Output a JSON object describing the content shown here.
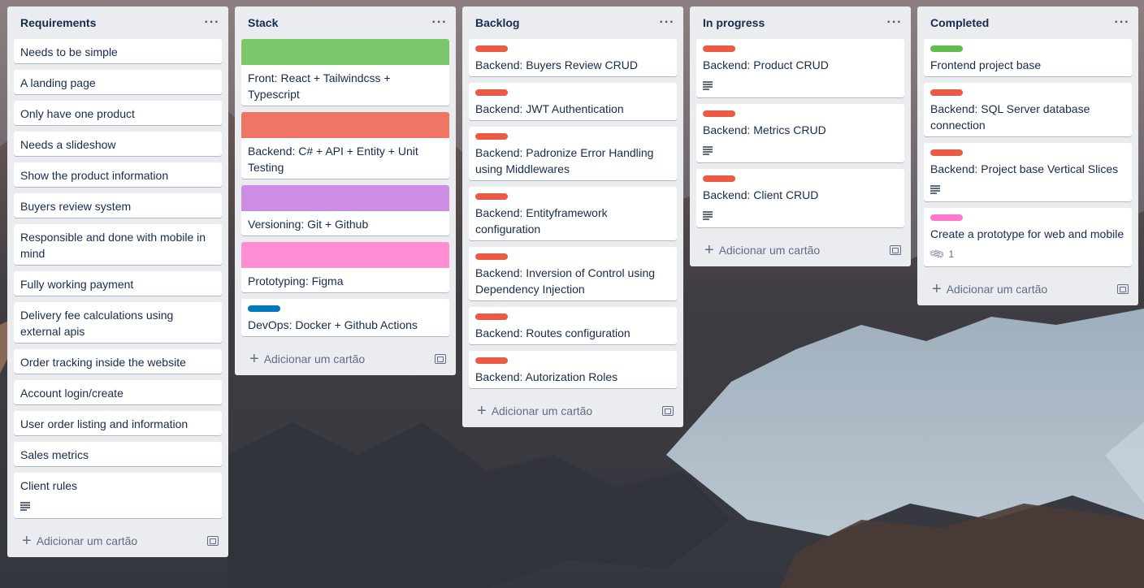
{
  "colors": {
    "red": "#eb5a46",
    "green": "#61bd4f",
    "blue": "#0079bf",
    "pink": "#ff78cb",
    "cover_green": "#7bc86c",
    "cover_salmon": "#ef7564",
    "cover_purple": "#cd8de5",
    "cover_pink": "#ff8ed4"
  },
  "icons": {
    "menu": "···",
    "plus": "+",
    "attachment": "paperclip-icon"
  },
  "lists": [
    {
      "title": "Requirements",
      "add_label": "Adicionar um cartão",
      "cards": [
        {
          "title": "Needs to be simple"
        },
        {
          "title": "A landing page"
        },
        {
          "title": "Only have one product"
        },
        {
          "title": "Needs a slideshow"
        },
        {
          "title": "Show the product information"
        },
        {
          "title": "Buyers review system"
        },
        {
          "title": "Responsible and done with mobile in mind"
        },
        {
          "title": "Fully working payment"
        },
        {
          "title": "Delivery fee calculations using external apis"
        },
        {
          "title": "Order tracking inside the website"
        },
        {
          "title": "Account login/create"
        },
        {
          "title": "User order listing and information"
        },
        {
          "title": "Sales metrics"
        },
        {
          "title": "Client rules",
          "has_description": true
        }
      ]
    },
    {
      "title": "Stack",
      "add_label": "Adicionar um cartão",
      "cards": [
        {
          "title": "Front: React + Tailwindcss + Typescript",
          "cover": "#7bc86c"
        },
        {
          "title": "Backend: C# + API + Entity + Unit Testing",
          "cover": "#ef7564"
        },
        {
          "title": "Versioning: Git + Github",
          "cover": "#cd8de5"
        },
        {
          "title": "Prototyping: Figma",
          "cover": "#ff8ed4"
        },
        {
          "title": "DevOps: Docker + Github Actions",
          "label": "#0079bf"
        }
      ]
    },
    {
      "title": "Backlog",
      "add_label": "Adicionar um cartão",
      "cards": [
        {
          "title": "Backend: Buyers Review CRUD",
          "label": "#eb5a46"
        },
        {
          "title": "Backend: JWT Authentication",
          "label": "#eb5a46"
        },
        {
          "title": "Backend: Padronize Error Handling using Middlewares",
          "label": "#eb5a46"
        },
        {
          "title": "Backend: Entityframework configuration",
          "label": "#eb5a46"
        },
        {
          "title": "Backend: Inversion of Control using Dependency Injection",
          "label": "#eb5a46"
        },
        {
          "title": "Backend: Routes configuration",
          "label": "#eb5a46"
        },
        {
          "title": "Backend: Autorization Roles",
          "label": "#eb5a46"
        }
      ]
    },
    {
      "title": "In progress",
      "add_label": "Adicionar um cartão",
      "cards": [
        {
          "title": "Backend: Product CRUD",
          "label": "#eb5a46",
          "has_description": true
        },
        {
          "title": "Backend: Metrics CRUD",
          "label": "#eb5a46",
          "has_description": true
        },
        {
          "title": "Backend: Client CRUD",
          "label": "#eb5a46",
          "has_description": true
        }
      ]
    },
    {
      "title": "Completed",
      "add_label": "Adicionar um cartão",
      "cards": [
        {
          "title": "Frontend project base",
          "label": "#61bd4f"
        },
        {
          "title": "Backend: SQL Server database connection",
          "label": "#eb5a46"
        },
        {
          "title": "Backend: Project base Vertical Slices",
          "label": "#eb5a46",
          "has_description": true
        },
        {
          "title": "Create a prototype for web and mobile",
          "label": "#ff78cb",
          "attachments": "1"
        }
      ]
    }
  ]
}
